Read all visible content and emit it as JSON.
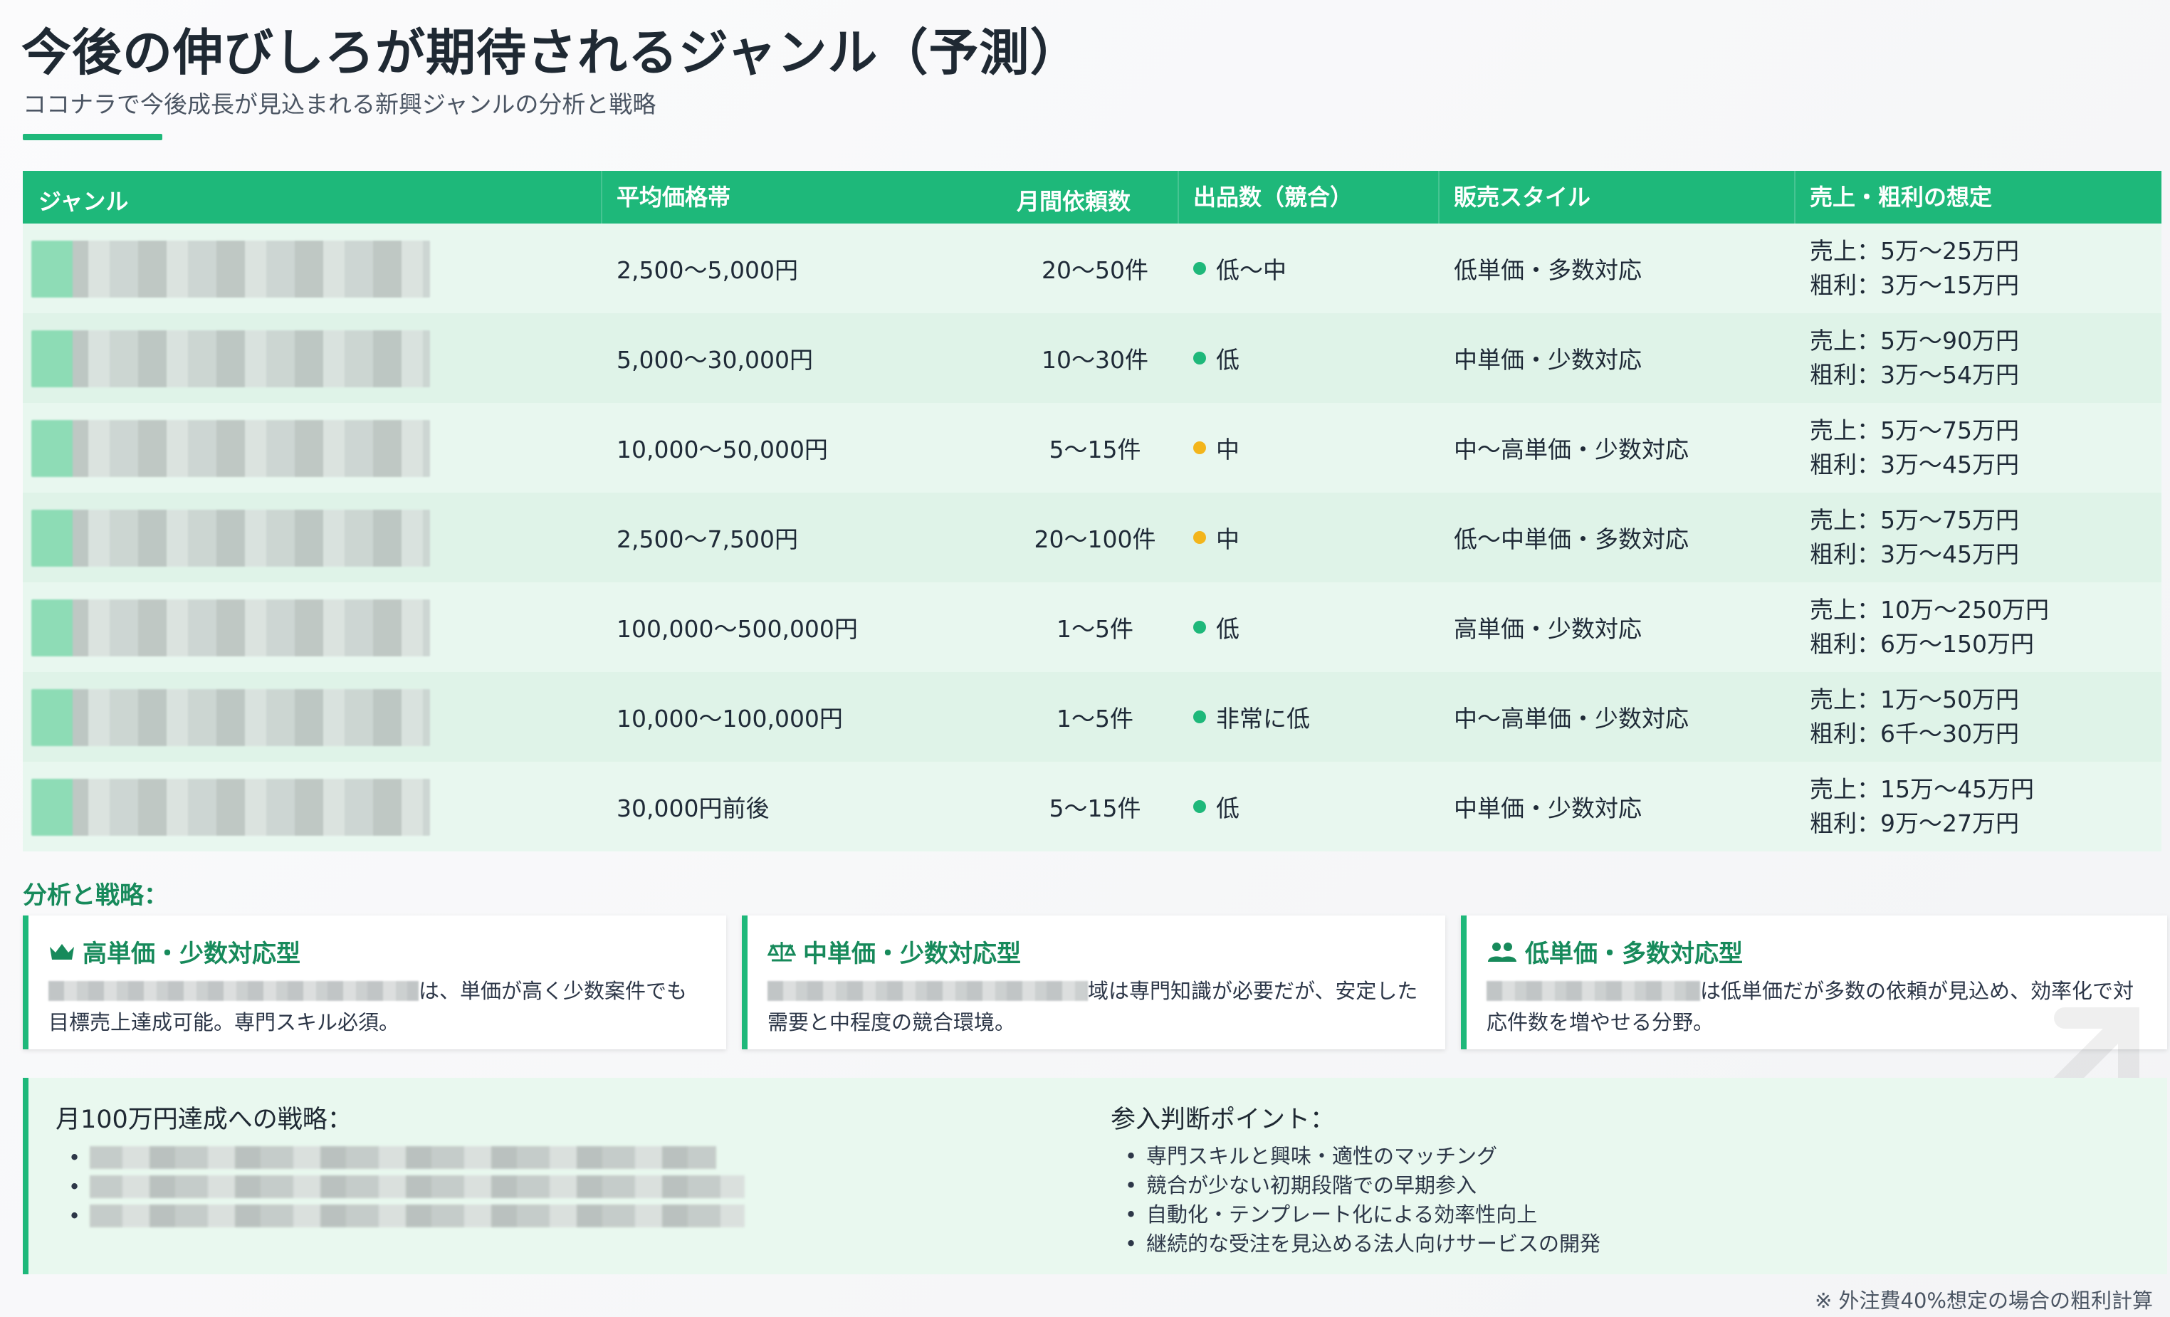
{
  "title": "今後の伸びしろが期待されるジャンル（予測）",
  "subtitle": "ココナラで今後成長が見込まれる新興ジャンルの分析と戦略",
  "table": {
    "headers": [
      "ジャンル",
      "平均価格帯",
      "月間依頼数",
      "出品数（競合）",
      "販売スタイル",
      "売上・粗利の想定"
    ],
    "rows": [
      {
        "price": "2,500〜5,000円",
        "requests": "20〜50件",
        "competition": "低〜中",
        "competition_color": "#1eb87a",
        "style": "低単価・多数対応",
        "sales": "売上：5万〜25万円",
        "profit": "粗利：3万〜15万円"
      },
      {
        "price": "5,000〜30,000円",
        "requests": "10〜30件",
        "competition": "低",
        "competition_color": "#1eb87a",
        "style": "中単価・少数対応",
        "sales": "売上：5万〜90万円",
        "profit": "粗利：3万〜54万円"
      },
      {
        "price": "10,000〜50,000円",
        "requests": "5〜15件",
        "competition": "中",
        "competition_color": "#f3b51b",
        "style": "中〜高単価・少数対応",
        "sales": "売上：5万〜75万円",
        "profit": "粗利：3万〜45万円"
      },
      {
        "price": "2,500〜7,500円",
        "requests": "20〜100件",
        "competition": "中",
        "competition_color": "#f3b51b",
        "style": "低〜中単価・多数対応",
        "sales": "売上：5万〜75万円",
        "profit": "粗利：3万〜45万円"
      },
      {
        "price": "100,000〜500,000円",
        "requests": "1〜5件",
        "competition": "低",
        "competition_color": "#1eb87a",
        "style": "高単価・少数対応",
        "sales": "売上：10万〜250万円",
        "profit": "粗利：6万〜150万円"
      },
      {
        "price": "10,000〜100,000円",
        "requests": "1〜5件",
        "competition": "非常に低",
        "competition_color": "#1eb87a",
        "style": "中〜高単価・少数対応",
        "sales": "売上：1万〜50万円",
        "profit": "粗利：6千〜30万円"
      },
      {
        "price": "30,000円前後",
        "requests": "5〜15件",
        "competition": "低",
        "competition_color": "#1eb87a",
        "style": "中単価・少数対応",
        "sales": "売上：15万〜45万円",
        "profit": "粗利：9万〜27万円"
      }
    ]
  },
  "analysis": {
    "label": "分析と戦略：",
    "cards": [
      {
        "icon": "crown-icon",
        "title": "高単価・少数対応型",
        "text_after_blur": "は、単価が高く少数案件でも",
        "line2": "目標売上達成可能。専門スキル必須。"
      },
      {
        "icon": "scale-icon",
        "title": "中単価・少数対応型",
        "text_after_blur": "域は専門知識が必要だが、安定した",
        "line2": "需要と中程度の競合環境。"
      },
      {
        "icon": "users-icon",
        "title": "低単価・多数対応型",
        "text_after_blur": "は低単価だが多数の依頼が見込め、効率化で対",
        "line2": "応件数を増やせる分野。"
      }
    ]
  },
  "strategy": {
    "left_title": "月100万円達成への戦略：",
    "right_title": "参入判断ポイント：",
    "points": [
      "専門スキルと興味・適性のマッチング",
      "競合が少ない初期段階での早期参入",
      "自動化・テンプレート化による効率性向上",
      "継続的な受注を見込める法人向けサービスの開発"
    ]
  },
  "footnote": "※ 外注費40%想定の場合の粗利計算",
  "colors": {
    "accent": "#1eb87a",
    "accent_dark": "#178a5b",
    "warning": "#f3b51b"
  }
}
